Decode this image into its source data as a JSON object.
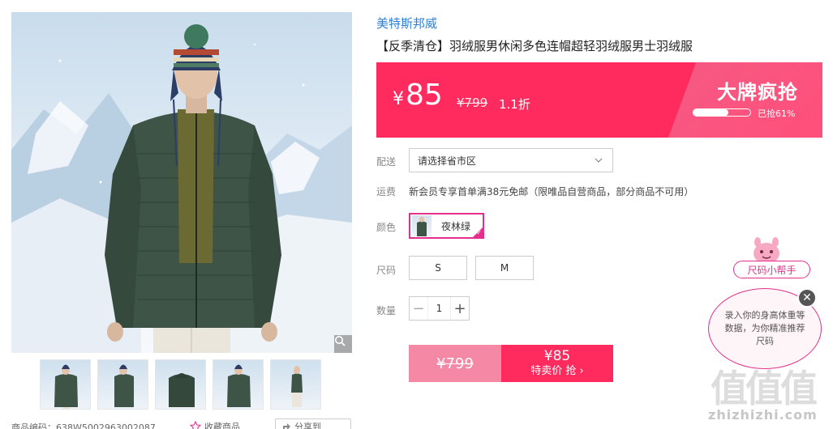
{
  "gallery": {
    "thumbnail_count": 5,
    "zoom_icon": "magnifier-icon"
  },
  "product_meta": {
    "code_label": "商品编码：638W5002963002087",
    "favorite_label": "收藏商品",
    "share_label": "分享到"
  },
  "product": {
    "brand": "美特斯邦威",
    "title": "【反季清仓】羽绒服男休闲多色连帽超轻羽绒服男士羽绒服"
  },
  "price_banner": {
    "currency": "¥",
    "price": "85",
    "original_price": "¥799",
    "discount": "1.1折",
    "promo_title": "大牌疯抢",
    "sold_percent": 61,
    "sold_text": "已抢61%"
  },
  "shipping": {
    "label": "配送",
    "select_value": "请选择省市区"
  },
  "freight": {
    "label": "运费",
    "text": "新会员专享首单满38元免邮（限唯品自营商品，部分商品不可用）"
  },
  "color": {
    "label": "颜色",
    "selected": "夜林绿"
  },
  "size": {
    "label": "尺码",
    "options": [
      "S",
      "M"
    ]
  },
  "quantity": {
    "label": "数量",
    "value": "1",
    "minus": "−",
    "plus": "+"
  },
  "buy": {
    "original_price": "¥799",
    "special_price": "¥85",
    "special_label": "特卖价 抢 ›"
  },
  "size_helper": {
    "button_label": "尺码小帮手",
    "bubble_text": "录入你的身高体重等数据，为你精准推荐尺码",
    "close": "✕"
  },
  "watermark": {
    "text": "值值值",
    "url": "zhizhizhi.com"
  },
  "colors": {
    "accent": "#ff2a5e",
    "brand_link": "#2d7ed6",
    "selection": "#e4308c"
  }
}
